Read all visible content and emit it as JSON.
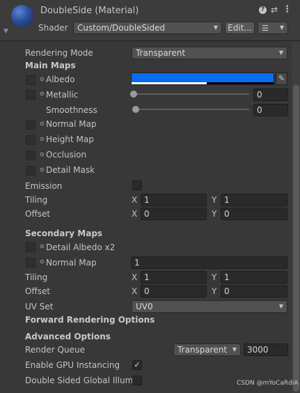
{
  "header": {
    "title": "DoubleSide (Material)",
    "shader_label": "Shader",
    "shader_value": "Custom/DoubleSided",
    "edit_button": "Edit...",
    "icons": [
      "help-icon",
      "preset-icon",
      "more-icon",
      "list-icon",
      "foldout-icon"
    ]
  },
  "rendering_mode": {
    "label": "Rendering Mode",
    "value": "Transparent"
  },
  "main_maps": {
    "heading": "Main Maps",
    "albedo": {
      "label": "Albedo",
      "color": "#0a6cf0"
    },
    "metallic": {
      "label": "Metallic",
      "value": "0"
    },
    "smoothness": {
      "label": "Smoothness",
      "value": "0"
    },
    "normal_map": {
      "label": "Normal Map"
    },
    "height_map": {
      "label": "Height Map"
    },
    "occlusion": {
      "label": "Occlusion"
    },
    "detail_mask": {
      "label": "Detail Mask"
    },
    "emission": {
      "label": "Emission",
      "checked": false
    },
    "tiling": {
      "label": "Tiling",
      "x": "1",
      "y": "1"
    },
    "offset": {
      "label": "Offset",
      "x": "0",
      "y": "0"
    }
  },
  "secondary_maps": {
    "heading": "Secondary Maps",
    "detail_albedo": {
      "label": "Detail Albedo x2"
    },
    "normal_map": {
      "label": "Normal Map",
      "value": "1"
    },
    "tiling": {
      "label": "Tiling",
      "x": "1",
      "y": "1"
    },
    "offset": {
      "label": "Offset",
      "x": "0",
      "y": "0"
    },
    "uv_set": {
      "label": "UV Set",
      "value": "UV0"
    }
  },
  "forward_rendering": {
    "heading": "Forward Rendering Options"
  },
  "advanced": {
    "heading": "Advanced Options",
    "render_queue": {
      "label": "Render Queue",
      "mode": "Transparent",
      "value": "3000"
    },
    "gpu_instancing": {
      "label": "Enable GPU Instancing",
      "checked": true
    },
    "double_sided_gi": {
      "label": "Double Sided Global Illumin",
      "checked": false
    }
  },
  "axis": {
    "x": "X",
    "y": "Y"
  },
  "watermark": "CSDN @mYoCaRdiA"
}
